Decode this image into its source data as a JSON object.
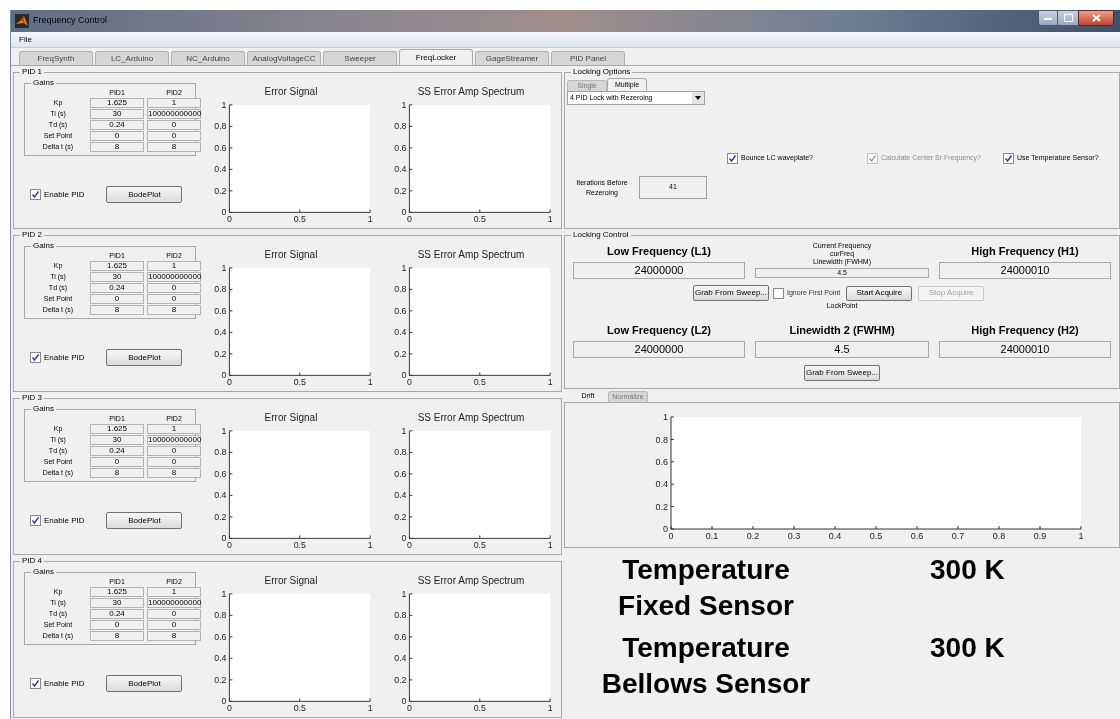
{
  "window": {
    "title": "Frequency Control"
  },
  "menu": [
    "File"
  ],
  "tabs": [
    {
      "label": "FreqSynth",
      "selected": false
    },
    {
      "label": "LC_Arduino",
      "selected": false
    },
    {
      "label": "NC_Arduino",
      "selected": false
    },
    {
      "label": "AnalogVoltageCC",
      "selected": false
    },
    {
      "label": "Sweeper",
      "selected": false
    },
    {
      "label": "FreqLocker",
      "selected": true
    },
    {
      "label": "GageStreamer",
      "selected": false
    },
    {
      "label": "PID Panel",
      "selected": false
    }
  ],
  "pid_panels": [
    {
      "title": "PID 1",
      "gains": {
        "title": "Gains",
        "columns": [
          "PID1",
          "PID2"
        ],
        "rows": [
          {
            "label": "Kp",
            "values": [
              "1.625",
              "1"
            ]
          },
          {
            "label": "Ti (s)",
            "values": [
              "30",
              "100000000000"
            ]
          },
          {
            "label": "Td (s)",
            "values": [
              "0.24",
              "0"
            ]
          },
          {
            "label": "Set Point",
            "values": [
              "0",
              "0"
            ]
          },
          {
            "label": "Delta t (s)",
            "values": [
              "8",
              "8"
            ]
          }
        ]
      },
      "enable_pid": {
        "label": "Enable PID",
        "checked": true
      },
      "bode_button": "BodePlot",
      "charts": [
        {
          "chart_data": {
            "type": "line",
            "title": "Error Signal",
            "xlim": [
              0,
              1
            ],
            "ylim": [
              0,
              1
            ],
            "xticks": [
              0,
              0.5,
              1
            ],
            "yticks": [
              0,
              0.2,
              0.4,
              0.6,
              0.8,
              1
            ]
          }
        },
        {
          "chart_data": {
            "type": "line",
            "title": "SS Error Amp Spectrum",
            "xlim": [
              0,
              1
            ],
            "ylim": [
              0,
              1
            ],
            "xticks": [
              0,
              0.5,
              1
            ],
            "yticks": [
              0,
              0.2,
              0.4,
              0.6,
              0.8,
              1
            ]
          }
        }
      ]
    },
    {
      "title": "PID 2",
      "gains": {
        "title": "Gains",
        "columns": [
          "PID1",
          "PID2"
        ],
        "rows": [
          {
            "label": "Kp",
            "values": [
              "1.625",
              "1"
            ]
          },
          {
            "label": "Ti (s)",
            "values": [
              "30",
              "100000000000"
            ]
          },
          {
            "label": "Td (s)",
            "values": [
              "0.24",
              "0"
            ]
          },
          {
            "label": "Set Point",
            "values": [
              "0",
              "0"
            ]
          },
          {
            "label": "Delta t (s)",
            "values": [
              "8",
              "8"
            ]
          }
        ]
      },
      "enable_pid": {
        "label": "Enable PID",
        "checked": true
      },
      "bode_button": "BodePlot",
      "charts": [
        {
          "chart_data": {
            "type": "line",
            "title": "Error Signal",
            "xlim": [
              0,
              1
            ],
            "ylim": [
              0,
              1
            ],
            "xticks": [
              0,
              0.5,
              1
            ],
            "yticks": [
              0,
              0.2,
              0.4,
              0.6,
              0.8,
              1
            ]
          }
        },
        {
          "chart_data": {
            "type": "line",
            "title": "SS Error Amp Spectrum",
            "xlim": [
              0,
              1
            ],
            "ylim": [
              0,
              1
            ],
            "xticks": [
              0,
              0.5,
              1
            ],
            "yticks": [
              0,
              0.2,
              0.4,
              0.6,
              0.8,
              1
            ]
          }
        }
      ]
    },
    {
      "title": "PID 3",
      "gains": {
        "title": "Gains",
        "columns": [
          "PID1",
          "PID2"
        ],
        "rows": [
          {
            "label": "Kp",
            "values": [
              "1.625",
              "1"
            ]
          },
          {
            "label": "Ti (s)",
            "values": [
              "30",
              "100000000000"
            ]
          },
          {
            "label": "Td (s)",
            "values": [
              "0.24",
              "0"
            ]
          },
          {
            "label": "Set Point",
            "values": [
              "0",
              "0"
            ]
          },
          {
            "label": "Delta t (s)",
            "values": [
              "8",
              "8"
            ]
          }
        ]
      },
      "enable_pid": {
        "label": "Enable PID",
        "checked": true
      },
      "bode_button": "BodePlot",
      "charts": [
        {
          "chart_data": {
            "type": "line",
            "title": "Error Signal",
            "xlim": [
              0,
              1
            ],
            "ylim": [
              0,
              1
            ],
            "xticks": [
              0,
              0.5,
              1
            ],
            "yticks": [
              0,
              0.2,
              0.4,
              0.6,
              0.8,
              1
            ]
          }
        },
        {
          "chart_data": {
            "type": "line",
            "title": "SS Error Amp Spectrum",
            "xlim": [
              0,
              1
            ],
            "ylim": [
              0,
              1
            ],
            "xticks": [
              0,
              0.5,
              1
            ],
            "yticks": [
              0,
              0.2,
              0.4,
              0.6,
              0.8,
              1
            ]
          }
        }
      ]
    },
    {
      "title": "PID 4",
      "gains": {
        "title": "Gains",
        "columns": [
          "PID1",
          "PID2"
        ],
        "rows": [
          {
            "label": "Kp",
            "values": [
              "1.625",
              "1"
            ]
          },
          {
            "label": "Ti (s)",
            "values": [
              "30",
              "100000000000"
            ]
          },
          {
            "label": "Td (s)",
            "values": [
              "0.24",
              "0"
            ]
          },
          {
            "label": "Set Point",
            "values": [
              "0",
              "0"
            ]
          },
          {
            "label": "Delta t (s)",
            "values": [
              "8",
              "8"
            ]
          }
        ]
      },
      "enable_pid": {
        "label": "Enable PID",
        "checked": true
      },
      "bode_button": "BodePlot",
      "charts": [
        {
          "chart_data": {
            "type": "line",
            "title": "Error Signal",
            "xlim": [
              0,
              1
            ],
            "ylim": [
              0,
              1
            ],
            "xticks": [
              0,
              0.5,
              1
            ],
            "yticks": [
              0,
              0.2,
              0.4,
              0.6,
              0.8,
              1
            ]
          }
        },
        {
          "chart_data": {
            "type": "line",
            "title": "SS Error Amp Spectrum",
            "xlim": [
              0,
              1
            ],
            "ylim": [
              0,
              1
            ],
            "xticks": [
              0,
              0.5,
              1
            ],
            "yticks": [
              0,
              0.2,
              0.4,
              0.6,
              0.8,
              1
            ]
          }
        }
      ]
    }
  ],
  "locking_options": {
    "title": "Locking Options",
    "tabs": [
      {
        "label": "Single",
        "selected": false
      },
      {
        "label": "Multiple",
        "selected": true
      }
    ],
    "mode": "4 PID Lock with Rezeroing",
    "checkboxes": [
      {
        "label": "Bounce LC waveplate?",
        "checked": true,
        "disabled": false
      },
      {
        "label": "Calculate Center Sr Frequency?",
        "checked": true,
        "disabled": true
      },
      {
        "label": "Use Temperature Sensor?",
        "checked": true,
        "disabled": false
      }
    ],
    "iterations": {
      "label": "Iterations Before Rezeroing",
      "value": "41"
    }
  },
  "locking_control": {
    "title": "Locking Control",
    "row1": {
      "low": {
        "label": "Low Frequency (L1)",
        "value": "24000000"
      },
      "current": {
        "lines": [
          "Current Frequency",
          "curFreq",
          "Linewidth (FWHM)"
        ],
        "value": "4.5"
      },
      "high": {
        "label": "High Frequency (H1)",
        "value": "24000010"
      }
    },
    "actions": {
      "grab": "Grab From Sweep...",
      "ignore_first": {
        "label": "Ignore First Point",
        "checked": false
      },
      "buttons": [
        {
          "label": "Start Acquire",
          "disabled": false
        },
        {
          "label": "Stop Acquire",
          "disabled": true
        }
      ],
      "lockpoint": "LockPoint"
    },
    "row2": [
      {
        "label": "Low Frequency (L2)",
        "value": "24000000"
      },
      {
        "label": "Linewidth 2 (FWHM)",
        "value": "4.5"
      },
      {
        "label": "High Frequency (H2)",
        "value": "24000010"
      }
    ],
    "grab2": "Grab From Sweep..."
  },
  "drift": {
    "tabs": [
      {
        "label": "Drift",
        "selected": true
      },
      {
        "label": "Normalize",
        "selected": false
      }
    ],
    "chart_data": {
      "type": "line",
      "xlim": [
        0,
        1
      ],
      "ylim": [
        0,
        1
      ],
      "xticks": [
        0,
        0.1,
        0.2,
        0.3,
        0.4,
        0.5,
        0.6,
        0.7,
        0.8,
        0.9,
        1
      ],
      "yticks": [
        0,
        0.2,
        0.4,
        0.6,
        0.8,
        1
      ]
    }
  },
  "temperatures": [
    {
      "name": "Temperature",
      "sensor": "Fixed Sensor",
      "value": "300 K"
    },
    {
      "name": "Temperature",
      "sensor": "Bellows Sensor",
      "value": "300 K"
    }
  ]
}
